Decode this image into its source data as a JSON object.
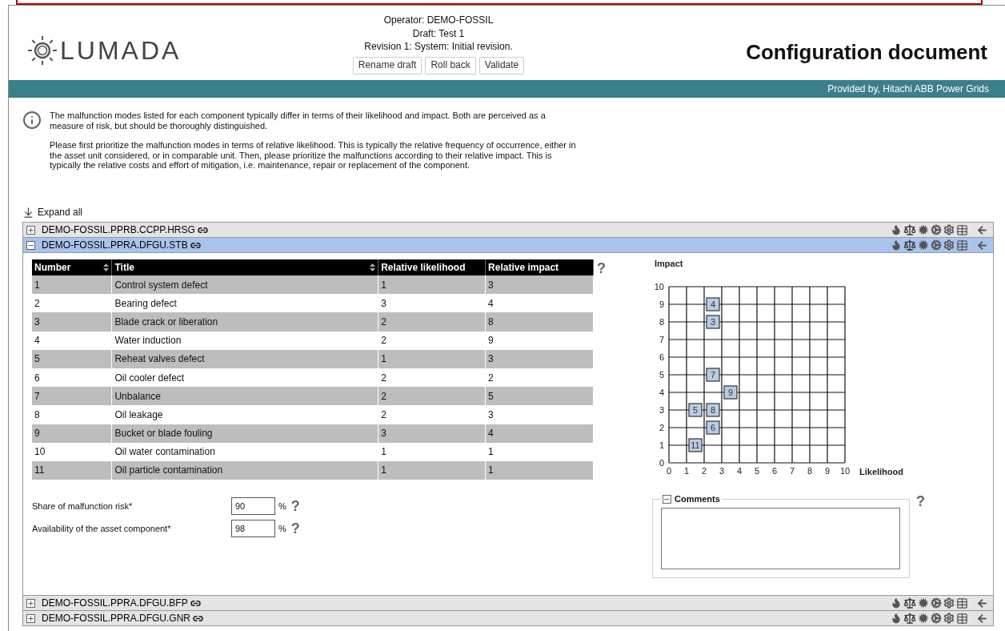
{
  "header": {
    "logo": "LUMADA",
    "operator": "Operator: DEMO-FOSSIL",
    "draft": "Draft: Test 1",
    "revision": "Revision 1: System: Initial revision.",
    "buttons": [
      "Rename draft",
      "Roll back",
      "Validate"
    ],
    "title": "Configuration document"
  },
  "banner": "Provided by, Hitachi ABB Power Grids",
  "info": [
    "The malfunction modes listed for each component typically differ in terms of their likelihood and impact. Both are perceived as a measure of risk, but should be thoroughly distinguished.",
    "Please first prioritize the malfunction modes in terms of relative likelihood. This is typically the relative frequency of occurrence, either in the asset unit considered, or in comparable unit. Then, please prioritize the malfunctions according to their relative impact. This is typically the relative costs and effort of mitigation, i.e. maintenance, repair or replacement of the component."
  ],
  "expand_all": "Expand all",
  "sections": [
    {
      "name": "DEMO-FOSSIL.PPRB.CCPP.HRSG",
      "expanded": false
    },
    {
      "name": "DEMO-FOSSIL.PPRA.DFGU.STB",
      "expanded": true
    },
    {
      "name": "DEMO-FOSSIL.PPRA.DFGU.BFP",
      "expanded": false
    },
    {
      "name": "DEMO-FOSSIL.PPRA.DFGU.GNR",
      "expanded": false
    }
  ],
  "detail": {
    "table": {
      "columns": [
        {
          "label": "Number",
          "sortable": true
        },
        {
          "label": "Title",
          "sortable": true
        },
        {
          "label": "Relative likelihood",
          "sortable": false
        },
        {
          "label": "Relative impact",
          "sortable": false
        }
      ],
      "help": "?",
      "rows": [
        [
          "1",
          "Control system defect",
          "1",
          "3"
        ],
        [
          "2",
          "Bearing defect",
          "3",
          "4"
        ],
        [
          "3",
          "Blade crack or liberation",
          "2",
          "8"
        ],
        [
          "4",
          "Water induction",
          "2",
          "9"
        ],
        [
          "5",
          "Reheat valves defect",
          "1",
          "3"
        ],
        [
          "6",
          "Oil cooler defect",
          "2",
          "2"
        ],
        [
          "7",
          "Unbalance",
          "2",
          "5"
        ],
        [
          "8",
          "Oil leakage",
          "2",
          "3"
        ],
        [
          "9",
          "Bucket or blade fouling",
          "3",
          "4"
        ],
        [
          "10",
          "Oil water contamination",
          "1",
          "1"
        ],
        [
          "11",
          "Oil particle contamination",
          "1",
          "1"
        ]
      ]
    },
    "fields": [
      {
        "label": "Share of malfunction risk*",
        "value": "90",
        "unit": "%",
        "help": "?"
      },
      {
        "label": "Availability of the asset component*",
        "value": "98",
        "unit": "%",
        "help": "?"
      }
    ],
    "chart": {
      "chart_data": {
        "type": "scatter",
        "xlabel": "Likelihood",
        "ylabel": "Impact",
        "xlim": [
          0,
          10
        ],
        "ylim": [
          0,
          10
        ],
        "xticks": [
          0,
          1,
          2,
          3,
          4,
          5,
          6,
          7,
          8,
          9,
          10
        ],
        "yticks": [
          0,
          1,
          2,
          3,
          4,
          5,
          6,
          7,
          8,
          9,
          10
        ],
        "grid": true,
        "series": [
          {
            "color": "#b8cce4",
            "x": [
              1.5,
              1.5,
              2.5,
              2.5,
              2.5,
              3.5,
              2.5,
              2.5
            ],
            "values": [
              1,
              3,
              3,
              2,
              5,
              4,
              8,
              9
            ]
          }
        ],
        "value_labels": [
          "11",
          "5",
          "8",
          "6",
          "7",
          "9",
          "3",
          "4"
        ]
      }
    },
    "comments": {
      "legend": "Comments",
      "expanded": true,
      "help": "?"
    }
  }
}
